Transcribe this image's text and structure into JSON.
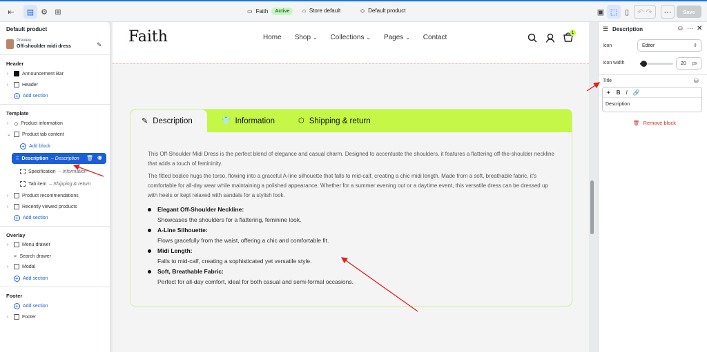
{
  "topbar": {
    "theme_name": "Faith",
    "status": "Active",
    "store": "Store default",
    "template": "Default product",
    "save_label": "Save"
  },
  "left": {
    "title": "Default product",
    "preview_label": "Preview",
    "preview_name": "Off-shoulder midi dress",
    "header_section": "Header",
    "header_items": [
      "Announcement Bar",
      "Header"
    ],
    "add_section": "Add section",
    "template_section": "Template",
    "template_items": [
      "Product information",
      "Product tab content"
    ],
    "add_block": "Add block",
    "blocks": [
      {
        "name": "Description",
        "sub": "– Description"
      },
      {
        "name": "Specification",
        "sub": "– Information"
      },
      {
        "name": "Tab item",
        "sub": "– Shipping & return"
      }
    ],
    "template_items2": [
      "Product recommendations",
      "Recently viewed products"
    ],
    "overlay_section": "Overlay",
    "overlay_items": [
      "Menu drawer",
      "Search drawer",
      "Modal"
    ],
    "footer_section": "Footer",
    "footer_items": [
      "Footer"
    ]
  },
  "store": {
    "logo": "Faith",
    "nav": [
      "Home",
      "Shop",
      "Collections",
      "Pages",
      "Contact"
    ],
    "cart_count": "1",
    "tabs": [
      "Description",
      "Information",
      "Shipping & return"
    ],
    "paragraphs": [
      "This Off-Shoulder Midi Dress is the perfect blend of elegance and casual charm. Designed to accentuate the shoulders, it features a flattering off-the-shoulder neckline that adds a touch of femininity.",
      "The fitted bodice hugs the torso, flowing into a graceful A-line silhouette that falls to mid-calf, creating a chic midi length. Made from a soft, breathable fabric, it's comfortable for all-day wear while maintaining a polished appearance. Whether for a summer evening out or a daytime event, this versatile dress can be dressed up with heels or kept relaxed with sandals for a stylish look."
    ],
    "bullets": [
      {
        "title": "Elegant Off-Shoulder Neckline:",
        "desc": "Showcases the shoulders for a flattering, feminine look."
      },
      {
        "title": "A-Line Silhouette:",
        "desc": "Flows gracefully from the waist, offering a chic and comfortable fit."
      },
      {
        "title": "Midi Length:",
        "desc": "Falls to mid-calf, creating a sophisticated yet versatile style."
      },
      {
        "title": "Soft, Breathable Fabric:",
        "desc": "Perfect for all-day comfort, ideal for both casual and semi-formal occasions."
      }
    ]
  },
  "right": {
    "title": "Description",
    "icon_label": "Icon",
    "icon_value": "Editor",
    "icon_width_label": "Icon width",
    "icon_width_value": "20",
    "icon_width_unit": "px",
    "icon_width_level": 0.1,
    "title_label": "Title",
    "title_value": "Description",
    "remove_block": "Remove block"
  },
  "colors": {
    "accent": "#c4f746",
    "selection": "#1a5fd6",
    "annotation": "#e02020"
  }
}
